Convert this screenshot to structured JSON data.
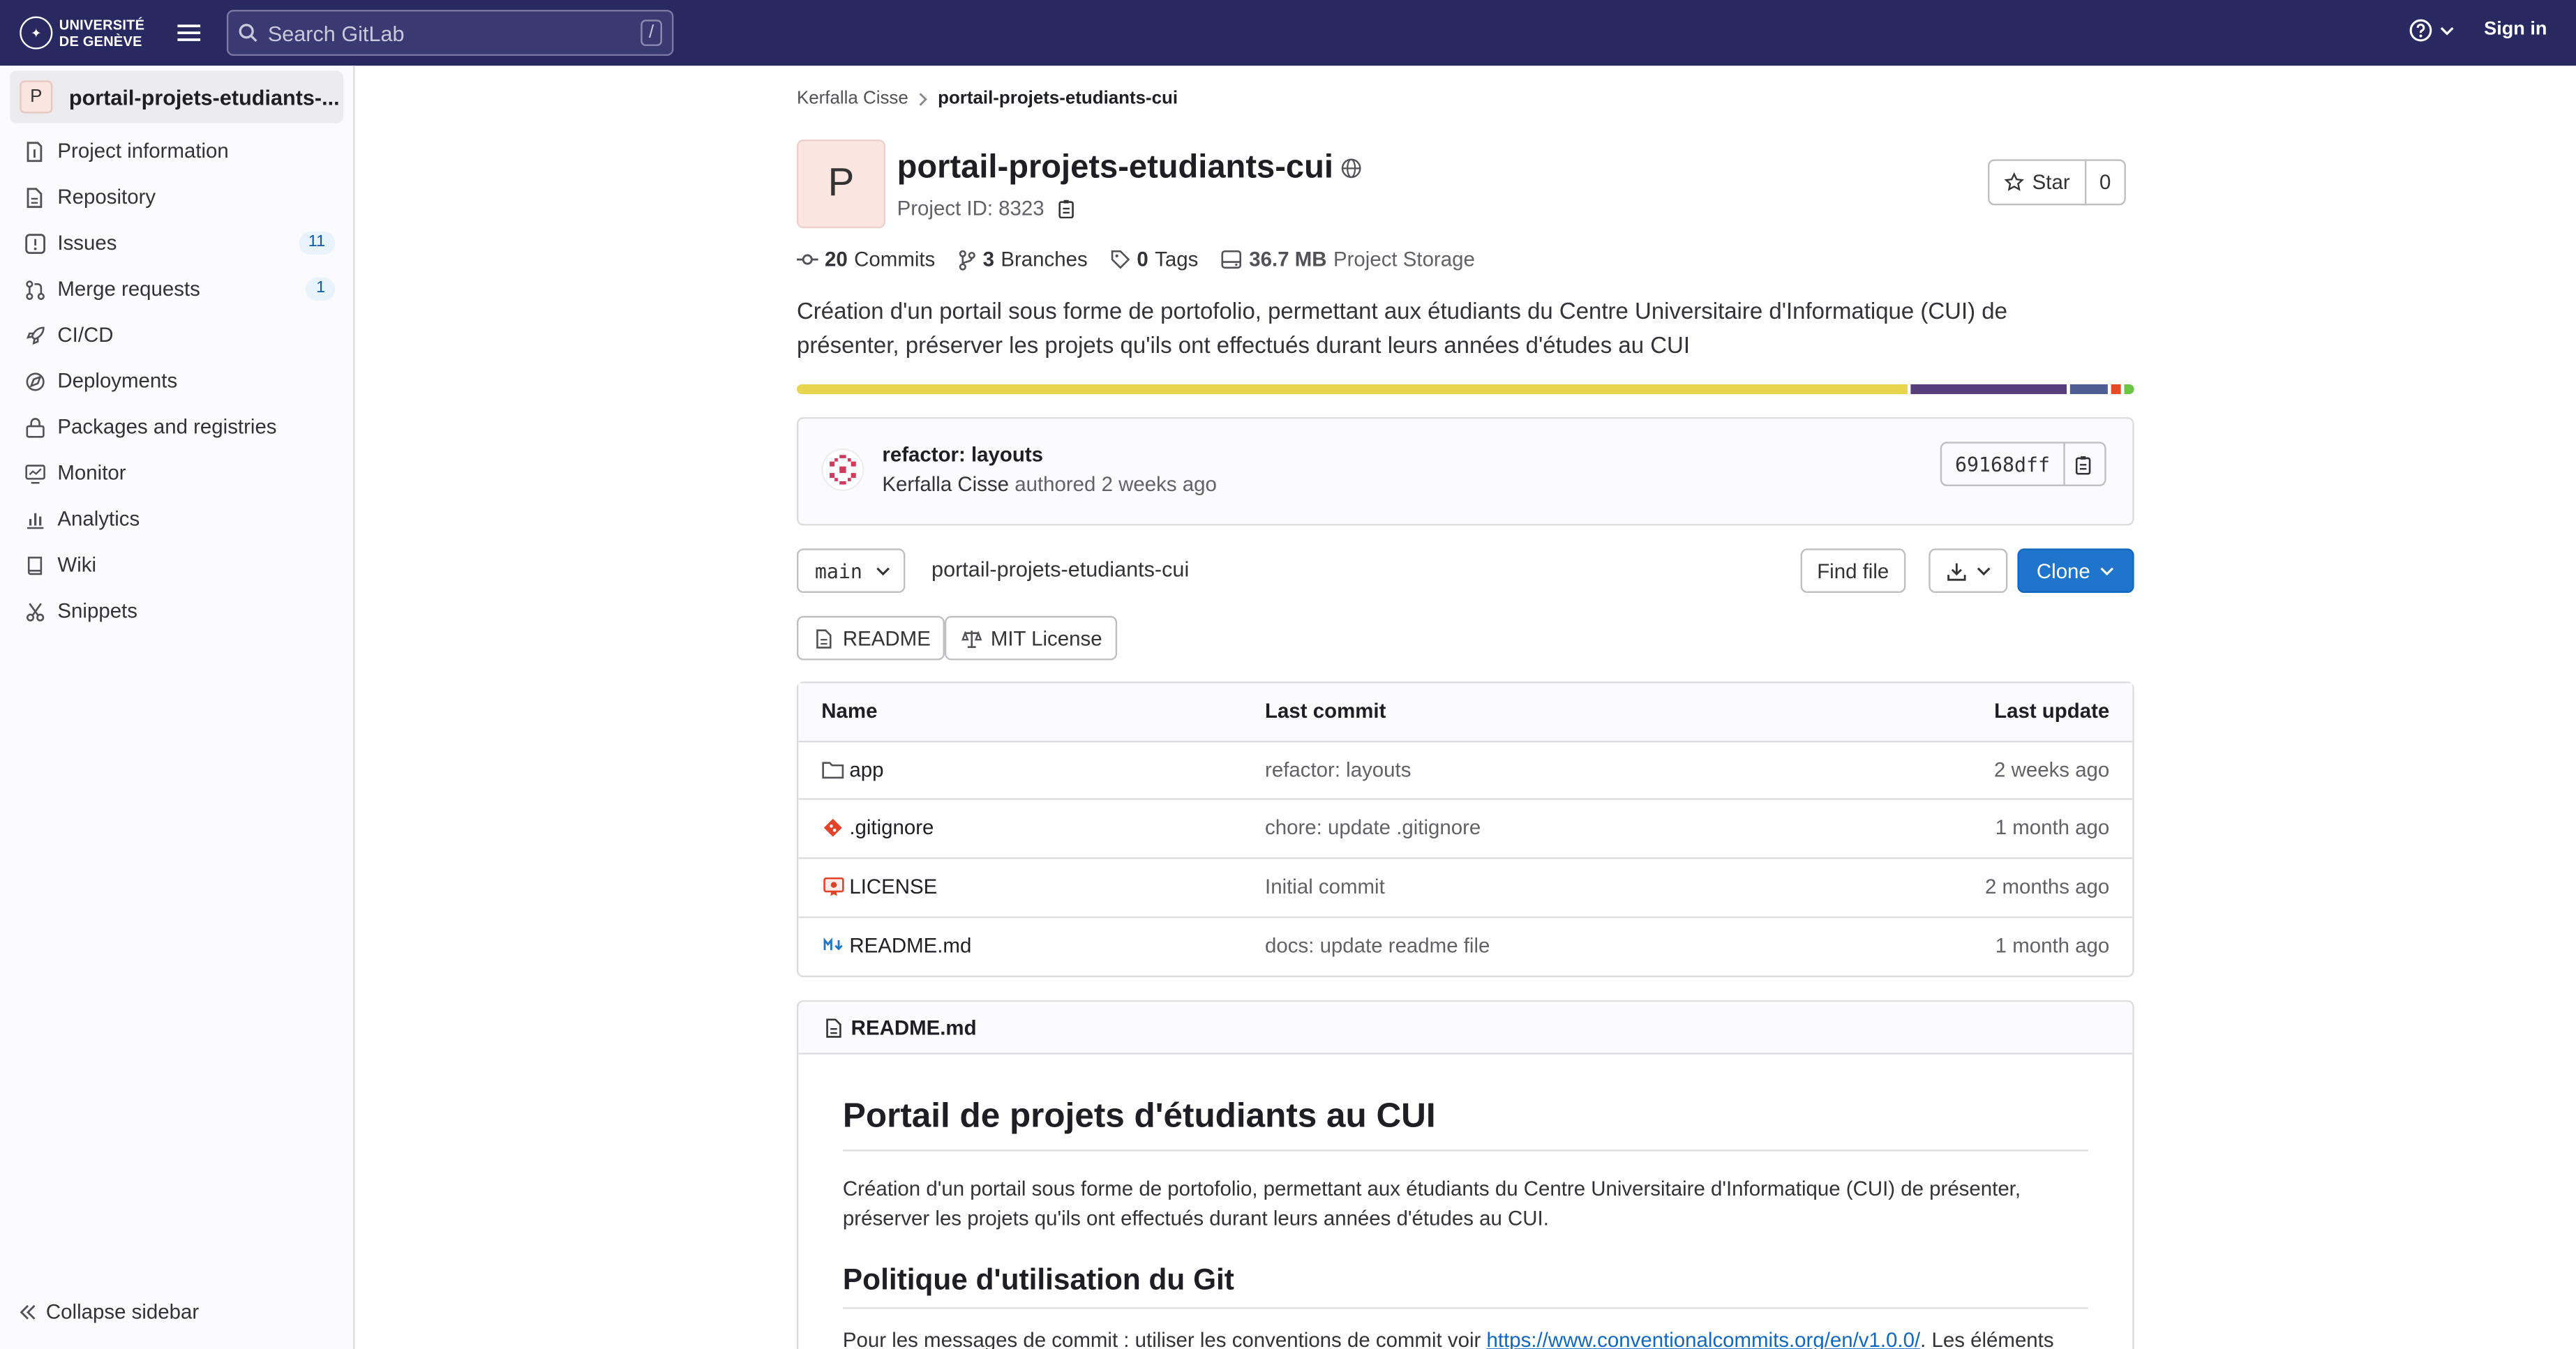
{
  "topbar": {
    "logo_line1": "UNIVERSITÉ",
    "logo_line2": "DE GENÈVE",
    "search_placeholder": "Search GitLab",
    "search_shortcut": "/",
    "signin": "Sign in"
  },
  "sidebar": {
    "project_avatar": "P",
    "project_name": "portail-projets-etudiants-...",
    "items": [
      {
        "label": "Project information",
        "icon": "info-icon"
      },
      {
        "label": "Repository",
        "icon": "doc-icon"
      },
      {
        "label": "Issues",
        "icon": "issues-icon",
        "badge": "11"
      },
      {
        "label": "Merge requests",
        "icon": "merge-request-icon",
        "badge": "1"
      },
      {
        "label": "CI/CD",
        "icon": "rocket-icon"
      },
      {
        "label": "Deployments",
        "icon": "deployments-icon"
      },
      {
        "label": "Packages and registries",
        "icon": "package-icon"
      },
      {
        "label": "Monitor",
        "icon": "monitor-icon"
      },
      {
        "label": "Analytics",
        "icon": "chart-icon"
      },
      {
        "label": "Wiki",
        "icon": "book-icon"
      },
      {
        "label": "Snippets",
        "icon": "snippet-icon"
      }
    ],
    "collapse": "Collapse sidebar"
  },
  "breadcrumb": {
    "owner": "Kerfalla Cisse",
    "project": "portail-projets-etudiants-cui"
  },
  "project": {
    "avatar": "P",
    "title": "portail-projets-etudiants-cui",
    "id_text": "Project ID: 8323",
    "star_label": "Star",
    "star_count": "0",
    "commits_num": "20",
    "commits_label": "Commits",
    "branches_num": "3",
    "branches_label": "Branches",
    "tags_num": "0",
    "tags_label": "Tags",
    "storage_num": "36.7 MB",
    "storage_label": "Project Storage",
    "description": "Création d'un portail sous forme de portofolio, permettant aux étudiants du Centre Universitaire d'Informatique (CUI) de présenter, préserver les projets qu'ils ont effectués durant leurs années d'études au CUI"
  },
  "language_bar": [
    {
      "share": 83,
      "color": "#e8d44d"
    },
    {
      "share": 12,
      "color": "#563d7c"
    },
    {
      "share": 3,
      "color": "#4f5d95"
    },
    {
      "share": 1,
      "color": "#e34c26"
    },
    {
      "share": 1,
      "color": "#6cc644"
    }
  ],
  "last_commit": {
    "title": "refactor: layouts",
    "author": "Kerfalla Cisse",
    "rest": "authored 2 weeks ago",
    "sha": "69168dff"
  },
  "controls": {
    "branch": "main",
    "path": "portail-projets-etudiants-cui",
    "find_file": "Find file",
    "clone": "Clone",
    "readme_pill": "README",
    "license_pill": "MIT License"
  },
  "file_table": {
    "headers": {
      "name": "Name",
      "commit": "Last commit",
      "update": "Last update"
    },
    "rows": [
      {
        "name": "app",
        "icon": "folder-icon",
        "commit": "refactor: layouts",
        "date": "2 weeks ago"
      },
      {
        "name": ".gitignore",
        "icon": "git-icon",
        "commit": "chore: update .gitignore",
        "date": "1 month ago"
      },
      {
        "name": "LICENSE",
        "icon": "license-icon",
        "commit": "Initial commit",
        "date": "2 months ago"
      },
      {
        "name": "README.md",
        "icon": "markdown-icon",
        "commit": "docs: update readme file",
        "date": "1 month ago"
      }
    ]
  },
  "readme": {
    "filename": "README.md",
    "h1": "Portail de projets d'étudiants au CUI",
    "p1": "Création d'un portail sous forme de portofolio, permettant aux étudiants du Centre Universitaire d'Informatique (CUI) de présenter, préserver les projets qu'ils ont effectués durant leurs années d'études au CUI.",
    "h2": "Politique d'utilisation du Git",
    "p2_start": "Pour les messages de commit : utiliser les conventions de commit voir ",
    "p2_link": "https://www.conventionalcommits.org/en/v1.0.0/",
    "p2_end": ". Les éléments"
  }
}
